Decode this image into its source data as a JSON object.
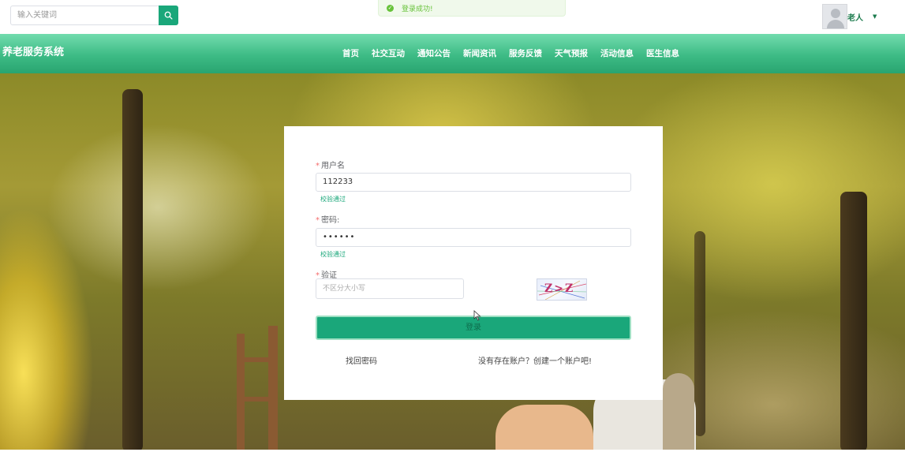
{
  "search": {
    "placeholder": "输入关键词"
  },
  "toast": {
    "message": "登录成功!"
  },
  "user": {
    "name": "老人"
  },
  "brand": "养老服务系统",
  "nav": [
    "首页",
    "社交互动",
    "通知公告",
    "新闻资讯",
    "服务反馈",
    "天气预报",
    "活动信息",
    "医生信息"
  ],
  "login": {
    "username_label": "用户名",
    "username_value": "112233",
    "username_hint": "校验通过",
    "password_label": "密码:",
    "password_value": "••••••",
    "password_hint": "校验通过",
    "code_label": "验证",
    "code_placeholder": "不区分大小写",
    "captcha_text": "Z>Z",
    "submit_label": "登录",
    "forgot_label": "找回密码",
    "register_label": "没有存在账户？创建一个账户吧!"
  },
  "colors": {
    "primary": "#1aa77a",
    "nav_gradient_top": "#72dcae",
    "nav_gradient_bottom": "#29a570",
    "required": "#f56c6c",
    "success": "#67c23a"
  }
}
